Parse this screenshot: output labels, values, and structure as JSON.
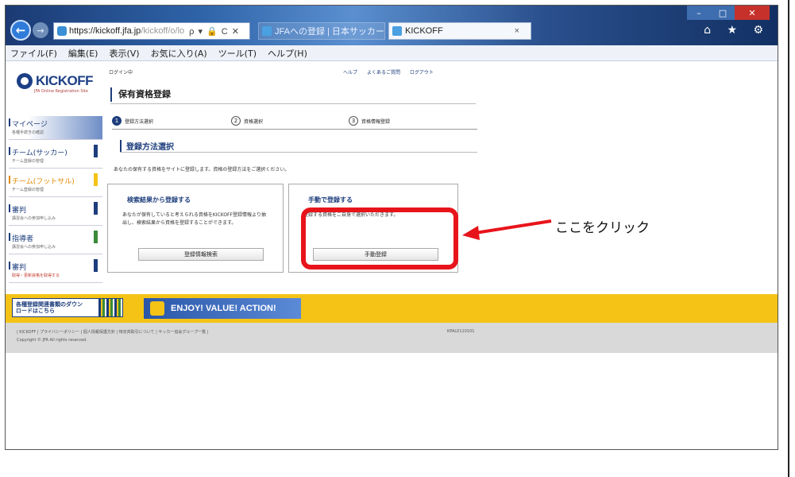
{
  "browser": {
    "url_main": "https://",
    "url_domain": "kickoff.jfa.jp",
    "url_rest": "/kickoff/o/lo",
    "addr_controls": "ρ ▾ 🔒 C ✕",
    "tabs": [
      {
        "label": "JFAへの登録 | 日本サッカー..."
      },
      {
        "label": "KICKOFF",
        "close": "×"
      }
    ],
    "menu": [
      "ファイル(F)",
      "編集(E)",
      "表示(V)",
      "お気に入り(A)",
      "ツール(T)",
      "ヘルプ(H)"
    ],
    "toolbar_icons": "⌂ ★ ⚙"
  },
  "site": {
    "logo": "KICKOFF",
    "logo_sub": "JFA Online Registration Site",
    "status": "ログイン中",
    "top_links": [
      "ヘルプ",
      "よくあるご質問",
      "ログアウト"
    ],
    "page_title": "保有資格登録",
    "steps": [
      {
        "num": "1",
        "label": "登録方法選択"
      },
      {
        "num": "2",
        "label": "資格選択"
      },
      {
        "num": "3",
        "label": "資格情報登録"
      }
    ],
    "section_title": "登録方法選択",
    "description": "あなたの保有する資格をサイトに登録します。資格の登録方法をご選択ください。",
    "option_search": {
      "heading": "検索結果から登録する",
      "body": "あなたが保有していると考えられる資格をKICKOFF登録情報より抽出し、検索結果から資格を登録することができます。",
      "button": "登録情報検索"
    },
    "option_manual": {
      "heading": "手動で登録する",
      "body": "登録する資格をご自身で選択いただきます。",
      "button": "手動登録"
    },
    "sidebar": [
      {
        "label": "マイページ",
        "sub": "各種手続きの確認"
      },
      {
        "label": "チーム(サッカー)",
        "sub": "チーム登録の管理"
      },
      {
        "label": "チーム(フットサル)",
        "sub": "チーム登録の管理"
      },
      {
        "label": "審判",
        "sub": "講習会への参加申し込み"
      },
      {
        "label": "指導者",
        "sub": "講習会への参加申し込み"
      },
      {
        "label": "審判",
        "sub": "取得・更新資格を取得する"
      }
    ],
    "download_banner": "各種登録関連書類のダウンロードはこちら",
    "enjoy_banner": "ENJOY! VALUE! ACTION!",
    "footer_links": "| KICKOFF | プライバシーポリシー | 個人情報保護方針 | 特定商取引について | サッカー協会グループ一覧 |",
    "footer_copy": "Copyright © JFA All rights reserved.",
    "footer_code": "KPAL0110101"
  },
  "annotation": {
    "callout": "ここをクリック",
    "color": "#e8141b"
  }
}
